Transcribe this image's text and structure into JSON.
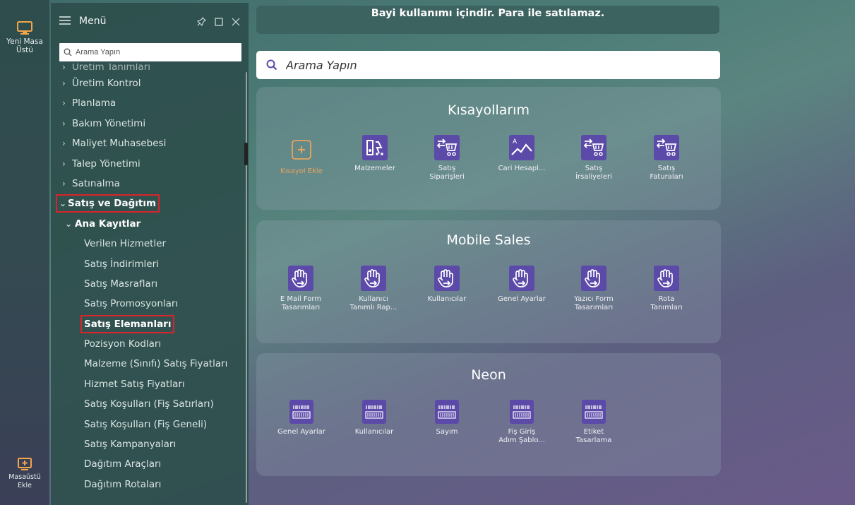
{
  "strip": {
    "top_item": "Yeni Masa\nÜstü",
    "bottom_item": "Masaüstü\nEkle"
  },
  "menu": {
    "title": "Menü",
    "search_placeholder": "Arama Yapın",
    "items": [
      {
        "label": "Üretim Tanımları",
        "level": 0,
        "cut": true
      },
      {
        "label": "Üretim Kontrol",
        "level": 0
      },
      {
        "label": "Planlama",
        "level": 0
      },
      {
        "label": "Bakım Yönetimi",
        "level": 0
      },
      {
        "label": "Maliyet Muhasebesi",
        "level": 0
      },
      {
        "label": "Talep Yönetimi",
        "level": 0
      },
      {
        "label": "Satınalma",
        "level": 0
      },
      {
        "label": "Satış ve Dağıtım",
        "level": 0,
        "expanded": true,
        "bold": true,
        "highlighted": true
      },
      {
        "label": "Ana Kayıtlar",
        "level": 1,
        "expanded": true,
        "bold": true
      },
      {
        "label": "Verilen Hizmetler",
        "level": 2
      },
      {
        "label": "Satış İndirimleri",
        "level": 2
      },
      {
        "label": "Satış Masrafları",
        "level": 2
      },
      {
        "label": "Satış Promosyonları",
        "level": 2
      },
      {
        "label": "Satış Elemanları",
        "level": 2,
        "bold": true,
        "highlighted": true
      },
      {
        "label": "Pozisyon Kodları",
        "level": 2
      },
      {
        "label": "Malzeme (Sınıfı) Satış Fiyatları",
        "level": 2
      },
      {
        "label": "Hizmet Satış Fiyatları",
        "level": 2
      },
      {
        "label": "Satış Koşulları (Fiş Satırları)",
        "level": 2
      },
      {
        "label": "Satış Koşulları (Fiş Geneli)",
        "level": 2
      },
      {
        "label": "Satış Kampanyaları",
        "level": 2
      },
      {
        "label": "Dağıtım Araçları",
        "level": 2
      },
      {
        "label": "Dağıtım Rotaları",
        "level": 2
      }
    ]
  },
  "banner": {
    "text": "Bayi kullanımı içindir. Para ile satılamaz."
  },
  "main_search": {
    "placeholder": "Arama Yapın"
  },
  "sections": {
    "shortcuts": {
      "title": "Kısayollarım",
      "tiles": [
        {
          "label": "Kısayol Ekle",
          "icon": "add-shortcut-icon"
        },
        {
          "label": "Malzemeler",
          "icon": "materials-icon"
        },
        {
          "label": "Satış\nSiparişleri",
          "icon": "sales-cart-icon"
        },
        {
          "label": "Cari Hesapl...",
          "icon": "account-chart-icon"
        },
        {
          "label": "Satış\nİrsaliyeleri",
          "icon": "sales-cart-icon"
        },
        {
          "label": "Satış\nFaturaları",
          "icon": "sales-cart-icon"
        }
      ]
    },
    "mobile": {
      "title": "Mobile Sales",
      "tiles": [
        {
          "label": "E Mail Form\nTasarımları",
          "icon": "hand-arrow-icon"
        },
        {
          "label": "Kullanıcı\nTanımlı Rap...",
          "icon": "hand-arrow-icon"
        },
        {
          "label": "Kullanıcılar",
          "icon": "hand-arrow-icon"
        },
        {
          "label": "Genel Ayarlar",
          "icon": "hand-arrow-icon"
        },
        {
          "label": "Yazıcı Form\nTasarımları",
          "icon": "hand-arrow-icon"
        },
        {
          "label": "Rota\nTanımları",
          "icon": "hand-arrow-icon"
        }
      ]
    },
    "neon": {
      "title": "Neon",
      "tiles": [
        {
          "label": "Genel Ayarlar",
          "icon": "barcode-icon"
        },
        {
          "label": "Kullanıcılar",
          "icon": "barcode-icon"
        },
        {
          "label": "Sayım",
          "icon": "barcode-icon"
        },
        {
          "label": "Fiş Giriş\nAdım Şablo...",
          "icon": "barcode-icon"
        },
        {
          "label": "Etiket\nTasarlama",
          "icon": "barcode-icon"
        }
      ]
    }
  },
  "colors": {
    "tile_bg": "#5b4aa8",
    "highlight": "#d8242a",
    "add_orange": "#e7a55e"
  }
}
